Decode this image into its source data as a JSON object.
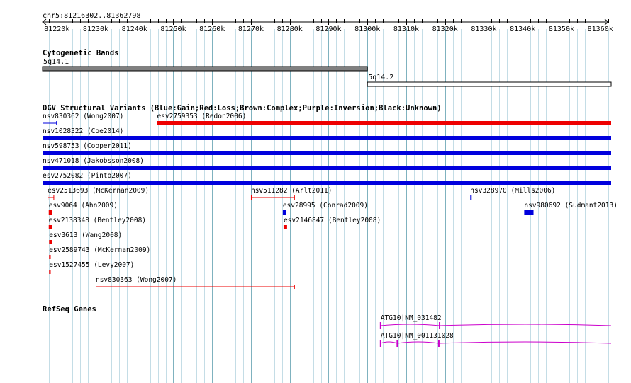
{
  "ruler": {
    "position_label": "chr5:81216302..81362798",
    "ticks": [
      "81220k",
      "81230k",
      "81240k",
      "81250k",
      "81260k",
      "81270k",
      "81280k",
      "81290k",
      "81300k",
      "81310k",
      "81320k",
      "81330k",
      "81340k",
      "81350k",
      "81360k"
    ]
  },
  "tracks": {
    "cytobands": {
      "title": "Cytogenetic Bands",
      "bands": [
        {
          "label": "5q14.1",
          "start": 81216302,
          "end": 81300000,
          "fill": "#808080"
        },
        {
          "label": "5q14.2",
          "start": 81300000,
          "end": 81362798,
          "fill": "#ffffff"
        }
      ]
    },
    "dgv": {
      "title": "DGV Structural Variants (Blue:Gain;Red:Loss;Brown:Complex;Purple:Inversion;Black:Unknown)",
      "colors": {
        "gain": "#0000dd",
        "loss": "#ee0000"
      },
      "variants": [
        {
          "label": "nsv830362 (Wong2007)",
          "start": 81216302,
          "end": 81220000,
          "color": "#0000dd",
          "style": "thin"
        },
        {
          "label": "esv2759353 (Redon2006)",
          "start": 81245800,
          "end": 81362798,
          "color": "#ee0000",
          "style": "thick"
        },
        {
          "label": "nsv1028322 (Coe2014)",
          "start": 81216302,
          "end": 81362798,
          "color": "#0000dd",
          "style": "thick"
        },
        {
          "label": "nsv598753 (Cooper2011)",
          "start": 81216302,
          "end": 81362798,
          "color": "#0000dd",
          "style": "thick"
        },
        {
          "label": "nsv471018 (Jakobsson2008)",
          "start": 81216302,
          "end": 81362798,
          "color": "#0000dd",
          "style": "thick"
        },
        {
          "label": "esv2752082 (Pinto2007)",
          "start": 81216302,
          "end": 81362798,
          "color": "#0000dd",
          "style": "thick"
        },
        {
          "label": "esv2513693 (McKernan2009)",
          "start": 81217600,
          "end": 81219300,
          "color": "#ee0000",
          "style": "thin"
        },
        {
          "label": "nsv511282 (Arlt2011)",
          "start": 81270000,
          "end": 81281300,
          "color": "#ee0000",
          "style": "thin"
        },
        {
          "label": "nsv328970 (Mills2006)",
          "start": 81326500,
          "end": 81326800,
          "color": "#0000dd",
          "style": "block"
        },
        {
          "label": "esv9064 (Ahn2009)",
          "start": 81217900,
          "end": 81218700,
          "color": "#ee0000",
          "style": "block"
        },
        {
          "label": "esv28995 (Conrad2009)",
          "start": 81278200,
          "end": 81279000,
          "color": "#0000dd",
          "style": "block"
        },
        {
          "label": "nsv980692 (Sudmant2013)",
          "start": 81340400,
          "end": 81342800,
          "color": "#0000dd",
          "style": "block"
        },
        {
          "label": "esv2138348 (Bentley2008)",
          "start": 81217900,
          "end": 81218700,
          "color": "#ee0000",
          "style": "block"
        },
        {
          "label": "esv2146847 (Bentley2008)",
          "start": 81278400,
          "end": 81279300,
          "color": "#ee0000",
          "style": "block"
        },
        {
          "label": "esv3613 (Wang2008)",
          "start": 81218000,
          "end": 81218700,
          "color": "#ee0000",
          "style": "block"
        },
        {
          "label": "esv2589743 (McKernan2009)",
          "start": 81218000,
          "end": 81218400,
          "color": "#ee0000",
          "style": "block"
        },
        {
          "label": "esv1527455 (Levy2007)",
          "start": 81218000,
          "end": 81218400,
          "color": "#ee0000",
          "style": "block"
        },
        {
          "label": "nsv830363 (Wong2007)",
          "start": 81230000,
          "end": 81281300,
          "color": "#ee0000",
          "style": "thin"
        }
      ]
    },
    "refseq": {
      "title": "RefSeq Genes",
      "color": "#cc00cc",
      "genes": [
        {
          "label": "ATG10|NM_031482",
          "start": 81303400,
          "end": 81362798,
          "exons": [
            81303400,
            81318600
          ],
          "strand": "+"
        },
        {
          "label": "ATG10|NM_001131028",
          "start": 81303400,
          "end": 81362798,
          "exons": [
            81303400,
            81307700,
            81318400
          ],
          "strand": "+"
        }
      ]
    }
  }
}
